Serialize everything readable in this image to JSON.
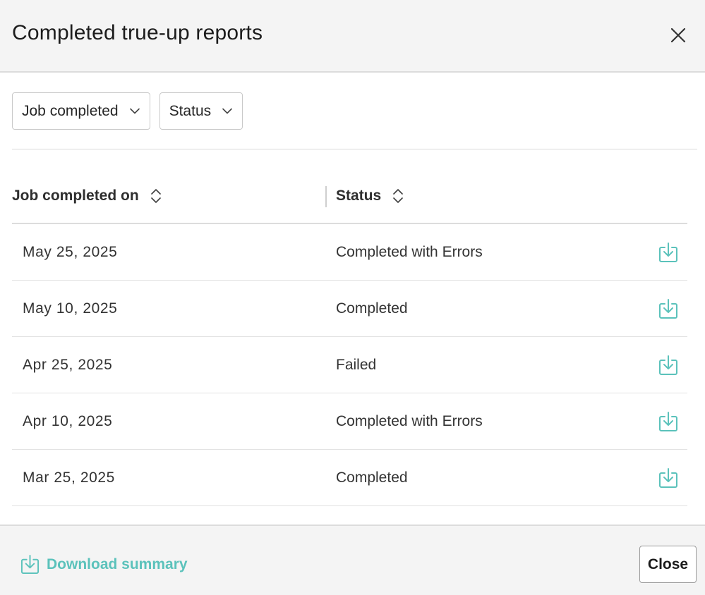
{
  "dialog": {
    "title": "Completed true-up reports",
    "close_icon": "close-icon"
  },
  "filters": {
    "job_completed_label": "Job completed",
    "status_label": "Status"
  },
  "table": {
    "columns": {
      "date": "Job completed on",
      "status": "Status"
    },
    "rows": [
      {
        "date": "May 25, 2025",
        "status": "Completed with Errors"
      },
      {
        "date": "May 10, 2025",
        "status": "Completed"
      },
      {
        "date": "Apr 25, 2025",
        "status": "Failed"
      },
      {
        "date": "Apr 10, 2025",
        "status": "Completed with Errors"
      },
      {
        "date": "Mar 25, 2025",
        "status": "Completed"
      }
    ],
    "row_action_icon": "download-icon"
  },
  "footer": {
    "download_summary_label": "Download summary",
    "close_label": "Close"
  },
  "colors": {
    "accent": "#5bc2bb",
    "header_bg": "#f4f4f4",
    "border": "#dcdcdc"
  }
}
